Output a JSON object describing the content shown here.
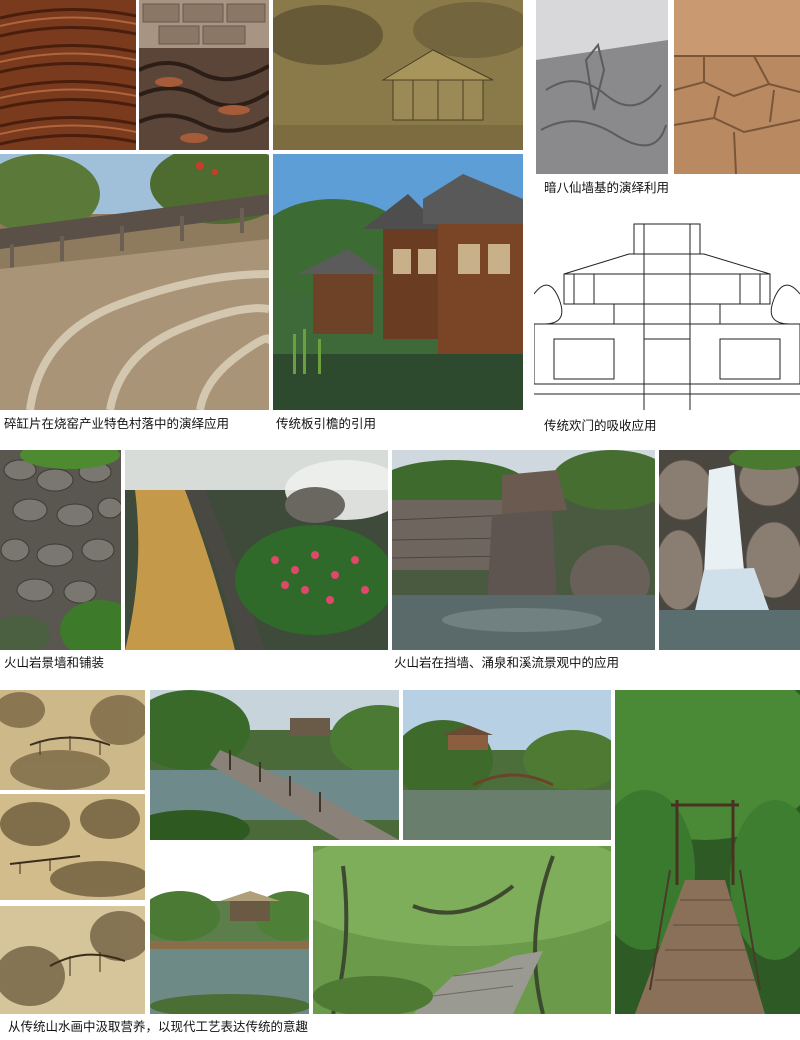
{
  "captions": {
    "tile_village": "碎缸片在烧窑产业特色村落中的演绎应用",
    "eaves": "传统板引檐的引用",
    "wall_base": "暗八仙墙基的演绎利用",
    "gate": "传统欢门的吸收应用",
    "volcanic_wall": "火山岩景墙和铺装",
    "volcanic_stream": "火山岩在挡墙、涌泉和溪流景观中的应用",
    "landscape_painting": "从传统山水画中汲取营养，以现代工艺表达传统的意趣"
  }
}
